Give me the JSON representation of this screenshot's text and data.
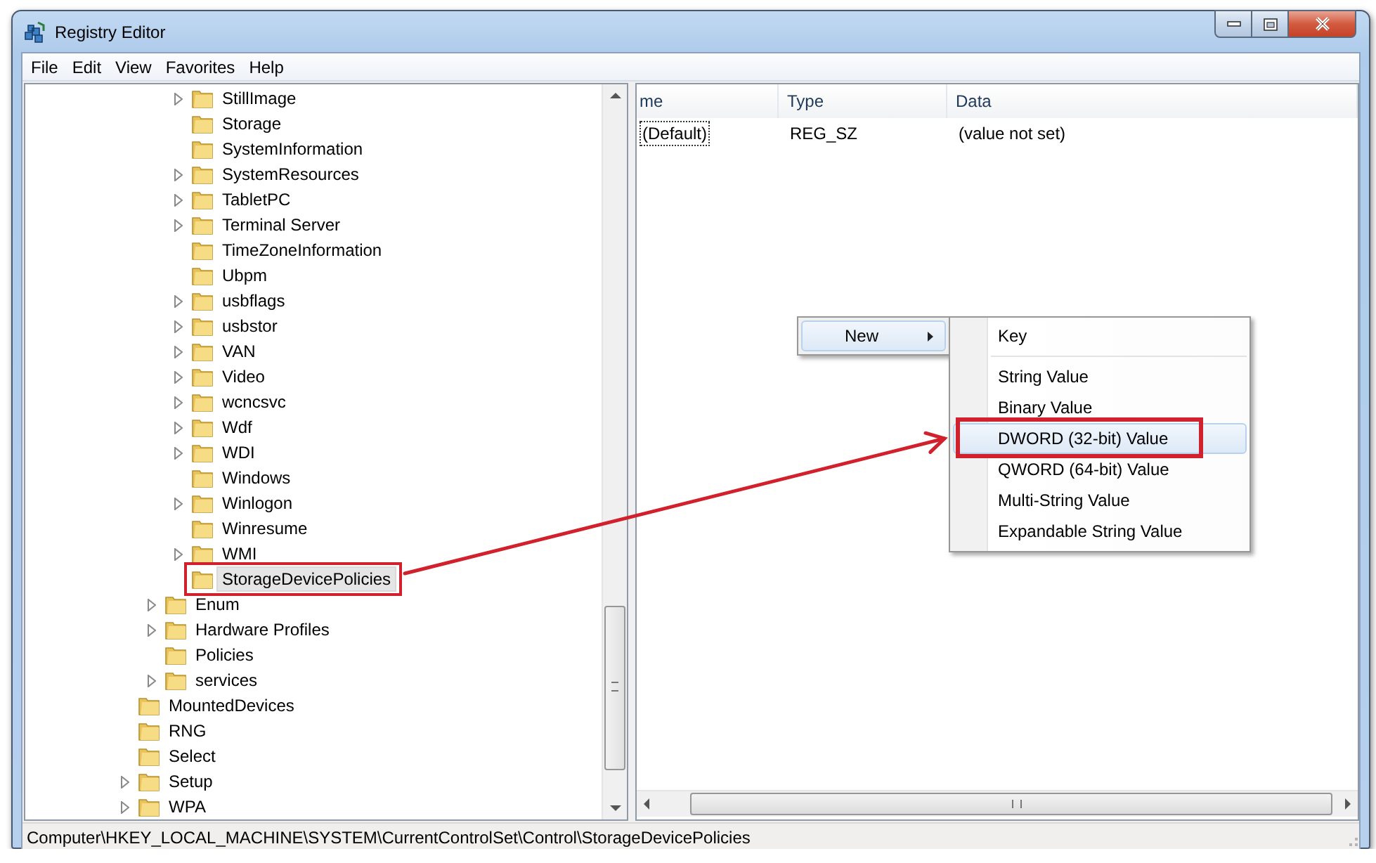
{
  "window": {
    "title": "Registry Editor"
  },
  "menu_bar": [
    "File",
    "Edit",
    "View",
    "Favorites",
    "Help"
  ],
  "tree": {
    "items": [
      {
        "children": [
          {
            "children": [
              {
                "label": "StillImage",
                "expandable": true,
                "selected": false,
                "annotated": false
              },
              {
                "label": "Storage",
                "expandable": false,
                "selected": false,
                "annotated": false
              },
              {
                "label": "SystemInformation",
                "expandable": false,
                "selected": false,
                "annotated": false
              },
              {
                "label": "SystemResources",
                "expandable": true,
                "selected": false,
                "annotated": false
              },
              {
                "label": "TabletPC",
                "expandable": true,
                "selected": false,
                "annotated": false
              },
              {
                "label": "Terminal Server",
                "expandable": true,
                "selected": false,
                "annotated": false
              },
              {
                "label": "TimeZoneInformation",
                "expandable": false,
                "selected": false,
                "annotated": false
              },
              {
                "label": "Ubpm",
                "expandable": false,
                "selected": false,
                "annotated": false
              },
              {
                "label": "usbflags",
                "expandable": true,
                "selected": false,
                "annotated": false
              },
              {
                "label": "usbstor",
                "expandable": true,
                "selected": false,
                "annotated": false
              },
              {
                "label": "VAN",
                "expandable": true,
                "selected": false,
                "annotated": false
              },
              {
                "label": "Video",
                "expandable": true,
                "selected": false,
                "annotated": false
              },
              {
                "label": "wcncsvc",
                "expandable": true,
                "selected": false,
                "annotated": false
              },
              {
                "label": "Wdf",
                "expandable": true,
                "selected": false,
                "annotated": false
              },
              {
                "label": "WDI",
                "expandable": true,
                "selected": false,
                "annotated": false
              },
              {
                "label": "Windows",
                "expandable": false,
                "selected": false,
                "annotated": false
              },
              {
                "label": "Winlogon",
                "expandable": true,
                "selected": false,
                "annotated": false
              },
              {
                "label": "Winresume",
                "expandable": false,
                "selected": false,
                "annotated": false
              },
              {
                "label": "WMI",
                "expandable": true,
                "selected": false,
                "annotated": false
              },
              {
                "label": "StorageDevicePolicies",
                "expandable": false,
                "selected": true,
                "annotated": true
              }
            ]
          },
          {
            "label": "Enum",
            "expandable": true,
            "selected": false,
            "annotated": false
          },
          {
            "label": "Hardware Profiles",
            "expandable": true,
            "selected": false,
            "annotated": false
          },
          {
            "label": "Policies",
            "expandable": false,
            "selected": false,
            "annotated": false
          },
          {
            "label": "services",
            "expandable": true,
            "selected": false,
            "annotated": false
          }
        ]
      },
      {
        "label": "MountedDevices",
        "expandable": false,
        "selected": false,
        "annotated": false
      },
      {
        "label": "RNG",
        "expandable": false,
        "selected": false,
        "annotated": false
      },
      {
        "label": "Select",
        "expandable": false,
        "selected": false,
        "annotated": false
      },
      {
        "label": "Setup",
        "expandable": true,
        "selected": false,
        "annotated": false
      },
      {
        "label": "WPA",
        "expandable": true,
        "selected": false,
        "annotated": false
      }
    ]
  },
  "values": {
    "columns": [
      "me",
      "Type",
      "Data"
    ],
    "rows": [
      {
        "name": "(Default)",
        "type": "REG_SZ",
        "data": "(value not set)",
        "focused": true
      }
    ]
  },
  "context_menu": {
    "items": [
      {
        "label": "New",
        "has_submenu": true,
        "selected": true
      }
    ]
  },
  "submenu": {
    "items": [
      {
        "label": "Key",
        "selected": false,
        "annotated": false,
        "separator_after": true
      },
      {
        "label": "String Value",
        "selected": false,
        "annotated": false,
        "separator_after": false
      },
      {
        "label": "Binary Value",
        "selected": false,
        "annotated": false,
        "separator_after": false
      },
      {
        "label": "DWORD (32-bit) Value",
        "selected": true,
        "annotated": true,
        "separator_after": false
      },
      {
        "label": "QWORD (64-bit) Value",
        "selected": false,
        "annotated": false,
        "separator_after": false
      },
      {
        "label": "Multi-String Value",
        "selected": false,
        "annotated": false,
        "separator_after": false
      },
      {
        "label": "Expandable String Value",
        "selected": false,
        "annotated": false,
        "separator_after": false
      }
    ]
  },
  "status_bar": "Computer\\HKEY_LOCAL_MACHINE\\SYSTEM\\CurrentControlSet\\Control\\StorageDevicePolicies"
}
